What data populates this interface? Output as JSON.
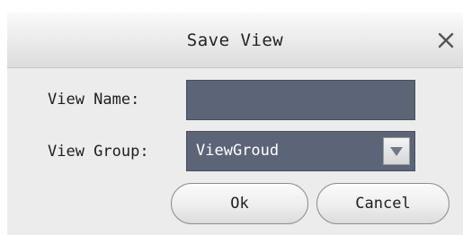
{
  "dialog": {
    "title": "Save View",
    "close_icon": "close-icon"
  },
  "form": {
    "view_name_label": "View Name:",
    "view_name_value": "",
    "view_group_label": "View Group:",
    "view_group_value": "ViewGroud",
    "dropdown_icon": "chevron-down-icon"
  },
  "buttons": {
    "ok_label": "Ok",
    "cancel_label": "Cancel"
  },
  "colors": {
    "field_background": "#5c6478",
    "field_text": "#ffffff"
  }
}
